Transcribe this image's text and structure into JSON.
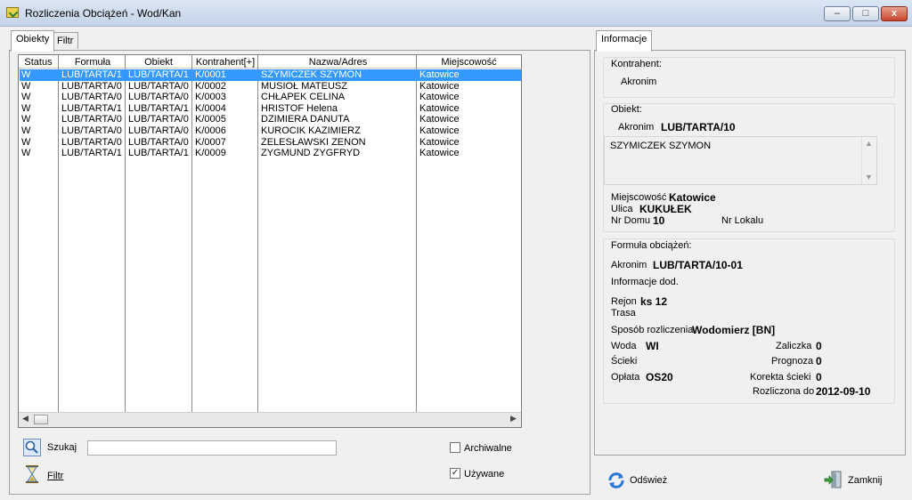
{
  "window": {
    "title": "Rozliczenia Obciążeń - Wod/Kan",
    "min": "–",
    "max": "□",
    "close": "x"
  },
  "left_tabs": [
    "Obiekty",
    "Filtr"
  ],
  "right_tabs": [
    "Informacje"
  ],
  "table": {
    "headers": [
      "Status",
      "Formuła",
      "Obiekt",
      "Kontrahent[+]",
      "Nazwa/Adres",
      "Miejscowość"
    ],
    "rows": [
      [
        "W",
        "LUB/TARTA/1",
        "LUB/TARTA/1",
        "K/0001",
        "SZYMICZEK SZYMON",
        "Katowice"
      ],
      [
        "W",
        "LUB/TARTA/0",
        "LUB/TARTA/0",
        "K/0002",
        "MUSIOŁ MATEUSZ",
        "Katowice"
      ],
      [
        "W",
        "LUB/TARTA/0",
        "LUB/TARTA/0",
        "K/0003",
        "CHŁAPEK CELINA",
        "Katowice"
      ],
      [
        "W",
        "LUB/TARTA/1",
        "LUB/TARTA/1",
        "K/0004",
        "HRISTOF Helena",
        "Katowice"
      ],
      [
        "W",
        "LUB/TARTA/0",
        "LUB/TARTA/0",
        "K/0005",
        "DZIMIERA DANUTA",
        "Katowice"
      ],
      [
        "W",
        "LUB/TARTA/0",
        "LUB/TARTA/0",
        "K/0006",
        "KUROCIK KAZIMIERZ",
        "Katowice"
      ],
      [
        "W",
        "LUB/TARTA/0",
        "LUB/TARTA/0",
        "K/0007",
        "ŻELESŁAWSKI ZENON",
        "Katowice"
      ],
      [
        "W",
        "LUB/TARTA/1",
        "LUB/TARTA/1",
        "K/0009",
        "ZYGMUND ZYGFRYD",
        "Katowice"
      ]
    ]
  },
  "bottom": {
    "search_label": "Szukaj",
    "search_value": "",
    "filter_label": "Filtr",
    "archiwalne_label": "Archiwalne",
    "archiwalne_checked": false,
    "uzywane_label": "Używane",
    "uzywane_checked": true,
    "check_mark": "✓"
  },
  "info": {
    "kontrahent_group": "Kontrahent:",
    "kontrahent_akronim_label": "Akronim",
    "obiekt_group": "Obiekt:",
    "obiekt_akronim_label": "Akronim",
    "obiekt_akronim": "LUB/TARTA/10",
    "obiekt_text": "SZYMICZEK SZYMON",
    "miejscowosc_label": "Miejscowość",
    "miejscowosc": "Katowice",
    "ulica_label": "Ulica",
    "ulica": "KUKUŁEK",
    "nr_domu_label": "Nr Domu",
    "nr_domu": "10",
    "nr_lokalu_label": "Nr Lokalu",
    "formula_group": "Formuła obciążeń:",
    "formula_akronim_label": "Akronim",
    "formula_akronim": "LUB/TARTA/10-01",
    "informacje_dod_label": "Informacje dod.",
    "rejon_label": "Rejon",
    "rejon": "ks 12",
    "trasa_label": "Trasa",
    "sposob_label": "Sposób rozliczenia",
    "sposob": "Wodomierz [BN]",
    "woda_label": "Woda",
    "woda": "WI",
    "scieki_label": "Ścieki",
    "oplata_label": "Opłata",
    "oplata": "OS20",
    "zaliczka_label": "Zaliczka",
    "zaliczka": "0",
    "prognoza_label": "Prognoza",
    "prognoza": "0",
    "korekta_label": "Korekta ścieki",
    "korekta": "0",
    "rozliczona_label": "Rozliczona do",
    "rozliczona": "2012-09-10"
  },
  "actions": {
    "refresh": "Odśwież",
    "close": "Zamknij"
  }
}
